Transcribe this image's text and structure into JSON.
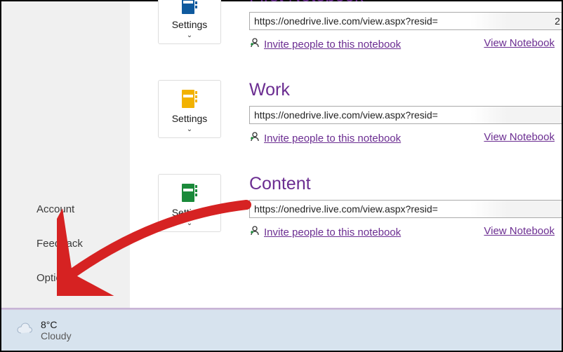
{
  "sidebar": {
    "items": [
      {
        "label": "Account"
      },
      {
        "label": "Feedback"
      },
      {
        "label": "Options"
      }
    ]
  },
  "tile": {
    "label": "Settings"
  },
  "links": {
    "invite": "Invite people to this notebook",
    "view": "View Notebook"
  },
  "notebooks": [
    {
      "title": "First Notebook",
      "url": "https://onedrive.live.com/view.aspx?resid=",
      "iconColor": "#0f5a9e"
    },
    {
      "title": "Work",
      "url": "https://onedrive.live.com/view.aspx?resid=",
      "iconColor": "#f2b200"
    },
    {
      "title": "Content",
      "url": "https://onedrive.live.com/view.aspx?resid=",
      "iconColor": "#1a8a3a"
    }
  ],
  "url_suffix": "2",
  "weather": {
    "temp": "8°C",
    "condition": "Cloudy"
  }
}
